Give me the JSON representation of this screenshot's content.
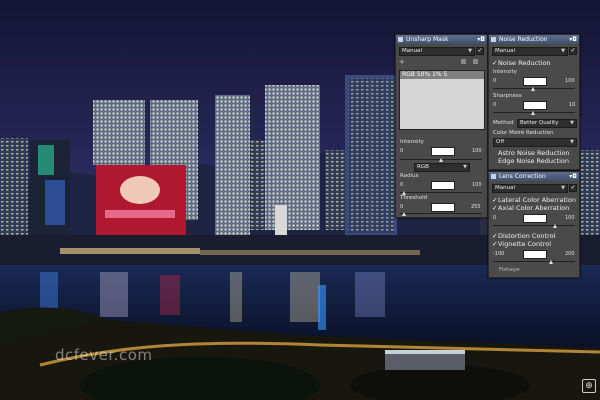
{
  "unsharp": {
    "title": "Unsharp Mask",
    "mode": "Manual",
    "preset": "RGB 50% 1% 5",
    "intensity_label": "Intensity",
    "intensity_min": "0",
    "intensity_max": "100",
    "channel": "RGB",
    "radius_label": "Radius",
    "radius_min": "0",
    "radius_max": "100",
    "threshold_label": "Threshold",
    "threshold_min": "0",
    "threshold_max": "255"
  },
  "noise": {
    "title": "Noise Reduction",
    "mode": "Manual",
    "enable_label": "Noise Reduction",
    "intensity_label": "Intensity",
    "intensity_min": "0",
    "intensity_max": "100",
    "sharpness_label": "Sharpness",
    "sharpness_min": "0",
    "sharpness_max": "10",
    "method_label": "Method",
    "method_value": "Better Quality",
    "color_moire_label": "Color Moiré Reduction",
    "color_moire_value": "Off",
    "astro_label": "Astro Noise Reduction",
    "edge_label": "Edge Noise Reduction"
  },
  "lens": {
    "title": "Lens Correction",
    "mode": "Manual",
    "lateral_label": "Lateral Color Aberration",
    "axial_label": "Axial Color Aberration",
    "axial_min": "0",
    "axial_max": "100",
    "distortion_label": "Distortion Control",
    "vignette_label": "Vignette Control",
    "vignette_min": "-100",
    "vignette_max": "200",
    "fisheye_label": "Fisheye"
  },
  "watermark": "dcfever.com",
  "colors": {
    "panel_bg": "#4a4a4a",
    "title_bar": "#4f5f7e",
    "sky": "#1c1e4a",
    "water": "#0b1a3a"
  }
}
